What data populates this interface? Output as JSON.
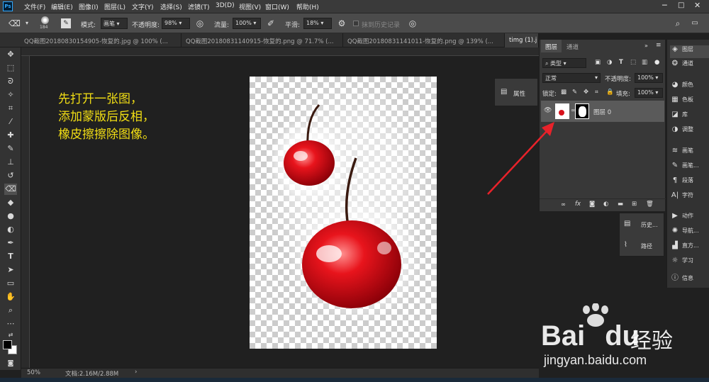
{
  "menubar": {
    "items": [
      "文件(F)",
      "编辑(E)",
      "图像(I)",
      "图层(L)",
      "文字(Y)",
      "选择(S)",
      "滤镜(T)",
      "3D(D)",
      "视图(V)",
      "窗口(W)",
      "帮助(H)"
    ],
    "ps_logo": "Ps"
  },
  "options": {
    "brush_size": "184",
    "mode_label": "模式:",
    "mode_value": "画笔",
    "opacity_label": "不透明度:",
    "opacity_value": "98%",
    "flow_label": "流量:",
    "flow_value": "100%",
    "smooth_label": "平滑:",
    "smooth_value": "18%",
    "erase_history_label": "抹到历史记录"
  },
  "tabs": [
    {
      "label": "QQ截图20180830154905-恢复的.jpg @ 100% (..."
    },
    {
      "label": "QQ截图20180831140915-恢复的.png @ 71.7% (..."
    },
    {
      "label": "QQ截图20180831141011-恢复的.png @ 139% (..."
    },
    {
      "label": "timg (1).j"
    }
  ],
  "annotation": {
    "line1": "先打开一张图，",
    "line2": "添加蒙版后反相，",
    "line3": "橡皮擦擦除图像。"
  },
  "status": {
    "zoom": "50%",
    "doc_info": "文档:2.16M/2.88M"
  },
  "layers_panel": {
    "tab_layers": "图层",
    "tab_channels": "通道",
    "kind_label": "类型",
    "blend_mode": "正常",
    "opacity_label": "不透明度:",
    "opacity_value": "100%",
    "lock_label": "锁定:",
    "fill_label": "填充:",
    "fill_value": "100%",
    "layer_name": "图层 0"
  },
  "properties_panel": {
    "label": "属性"
  },
  "mini_panels": {
    "history": "历史...",
    "paths": "路径"
  },
  "right_panel": {
    "items": [
      "图层",
      "通道",
      "颜色",
      "色板",
      "库",
      "调整",
      "画笔",
      "画笔...",
      "段落",
      "字符",
      "动作",
      "导航...",
      "直方...",
      "学习",
      "信息"
    ]
  },
  "watermark": {
    "brand": "Bai",
    "brand2": "du",
    "cn": "经验",
    "url": "jingyan.baidu.com"
  },
  "colors": {
    "annotation": "#f2de14",
    "arrow": "#e8222a",
    "cherry": "#d8121c"
  }
}
